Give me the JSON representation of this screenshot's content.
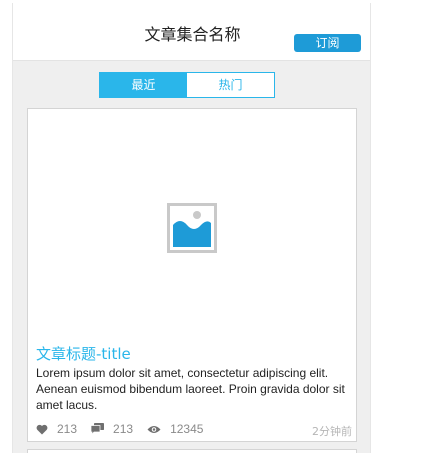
{
  "header": {
    "title": "文章集合名称",
    "subscribe_label": "订阅"
  },
  "tabs": [
    {
      "label": "最近",
      "active": true
    },
    {
      "label": "热门",
      "active": false
    }
  ],
  "article": {
    "image_icon": "image-placeholder-icon",
    "title": "文章标题-title",
    "excerpt": "Lorem ipsum dolor sit amet, consectetur adipiscing elit. Aenean euismod bibendum laoreet. Proin gravida dolor sit amet lacus.",
    "likes": "213",
    "comments": "213",
    "views": "12345",
    "time": "2分钟前"
  },
  "colors": {
    "accent": "#2ab6ea",
    "subscribe": "#1e9bd7",
    "background": "#efefef"
  }
}
